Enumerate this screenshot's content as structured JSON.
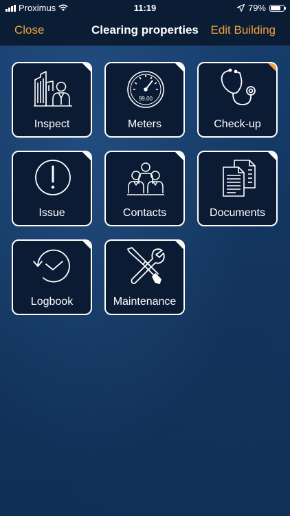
{
  "status_bar": {
    "carrier": "Proximus",
    "time": "11:19",
    "battery": "79%",
    "battery_level": 0.79,
    "icons": [
      "signal-icon",
      "wifi-icon",
      "location-arrow-icon",
      "battery-icon"
    ]
  },
  "nav": {
    "left": "Close",
    "title": "Clearing properties",
    "right": "Edit Building"
  },
  "colors": {
    "accent": "#f0a23a",
    "tile_bg": "#0b1b34",
    "background": "#12355f"
  },
  "tiles": [
    {
      "label": "Inspect",
      "icon": "building-person-icon"
    },
    {
      "label": "Meters",
      "icon": "meter-gauge-icon",
      "gauge_text": "99,00"
    },
    {
      "label": "Check-up",
      "icon": "stethoscope-icon",
      "flag": "orange"
    },
    {
      "label": "Issue",
      "icon": "exclamation-circle-icon"
    },
    {
      "label": "Contacts",
      "icon": "people-group-icon"
    },
    {
      "label": "Documents",
      "icon": "documents-icon"
    },
    {
      "label": "Logbook",
      "icon": "history-clock-icon"
    },
    {
      "label": "Maintenance",
      "icon": "wrench-screwdriver-icon"
    }
  ]
}
